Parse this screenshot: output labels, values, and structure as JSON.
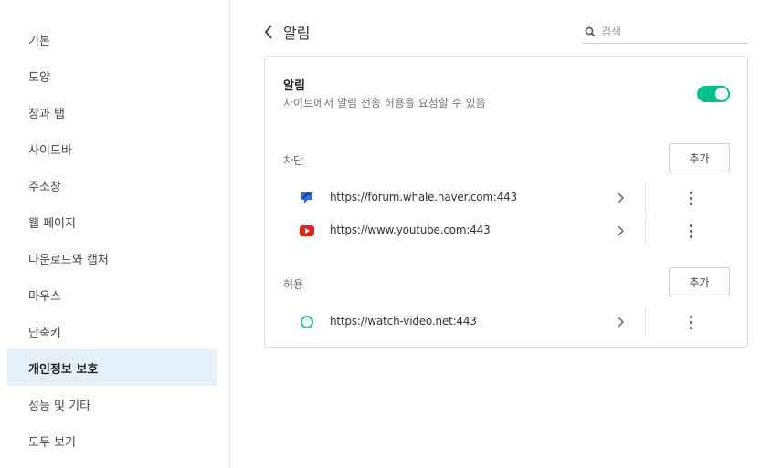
{
  "sidebar": {
    "items": [
      {
        "label": "기본"
      },
      {
        "label": "모양"
      },
      {
        "label": "창과 탭"
      },
      {
        "label": "사이드바"
      },
      {
        "label": "주소창"
      },
      {
        "label": "웹 페이지"
      },
      {
        "label": "다운로드와 캡처"
      },
      {
        "label": "마우스"
      },
      {
        "label": "단축키"
      },
      {
        "label": "개인정보 보호",
        "active": true
      },
      {
        "label": "성능 및 기타"
      },
      {
        "label": "모두 보기"
      }
    ]
  },
  "header": {
    "title": "알림",
    "back_icon": "chevron-left-icon"
  },
  "search": {
    "placeholder": "검색",
    "value": "",
    "icon": "search-icon"
  },
  "notifications": {
    "title": "알림",
    "description": "사이트에서 알림 전송 허용을 요청할 수 있음",
    "toggle_on": true,
    "toggle_color": "#00c28c"
  },
  "blocked": {
    "label": "차단",
    "add_label": "추가",
    "sites": [
      {
        "url": "https://forum.whale.naver.com:443",
        "icon": "whale-forum-icon"
      },
      {
        "url": "https://www.youtube.com:443",
        "icon": "youtube-icon"
      }
    ]
  },
  "allowed": {
    "label": "허용",
    "add_label": "추가",
    "sites": [
      {
        "url": "https://watch-video.net:443",
        "icon": "globe-circle-icon"
      }
    ]
  },
  "colors": {
    "accent": "#00c28c",
    "active_bg": "#e6f0fa",
    "youtube_red": "#e62117"
  }
}
